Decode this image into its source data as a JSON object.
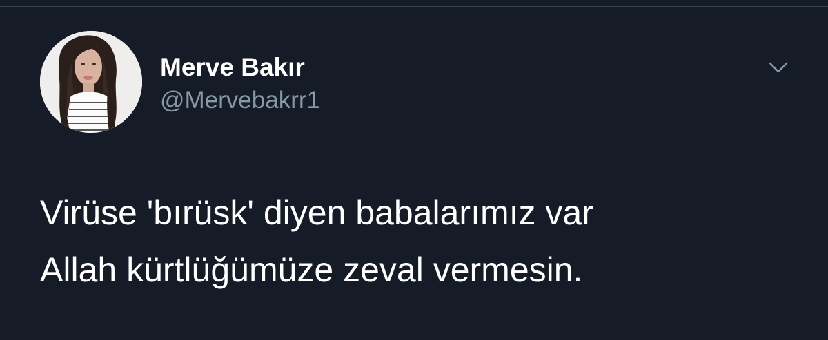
{
  "tweet": {
    "author": {
      "display_name": "Merve Bakır",
      "handle": "@Mervebakrr1"
    },
    "menu_icon": "chevron-down-icon",
    "text_lines": [
      "Virüse 'bırüsk' diyen babalarımız var",
      "Allah kürtlüğümüze zeval vermesin."
    ]
  },
  "colors": {
    "background": "#151c28",
    "display_name": "#ffffff",
    "handle": "#8899a6",
    "text": "#ffffff",
    "chevron": "#8899a6"
  }
}
